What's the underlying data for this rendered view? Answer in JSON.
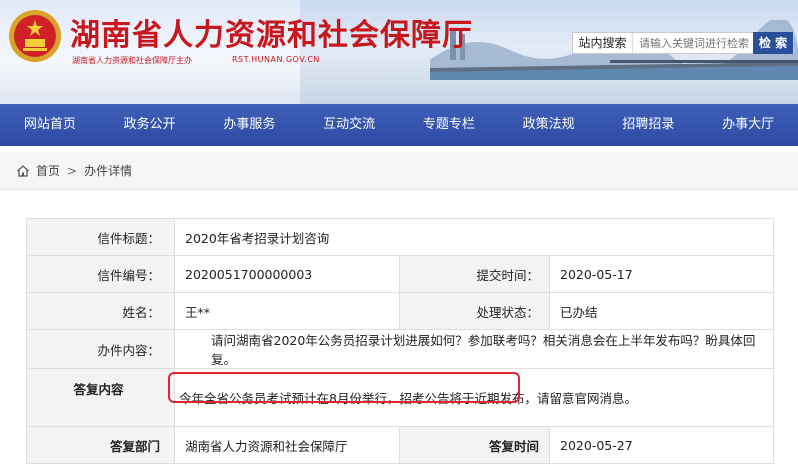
{
  "header": {
    "title": "湖南省人力资源和社会保障厅",
    "subtitle": "湖南省人力资源和社会保障厅主办",
    "url": "RST.HUNAN.GOV.CN",
    "search": {
      "label": "站内搜索",
      "placeholder": "请输入关键词进行检索",
      "button": "检 索"
    }
  },
  "nav": {
    "items": [
      "网站首页",
      "政务公开",
      "办事服务",
      "互动交流",
      "专题专栏",
      "政策法规",
      "招聘招录",
      "办事大厅"
    ]
  },
  "breadcrumb": {
    "home": "首页",
    "separator": ">",
    "current": "办件详情"
  },
  "detail": {
    "title_label": "信件标题：",
    "title_value": "2020年省考招录计划咨询",
    "number_label": "信件编号：",
    "number_value": "2020051700000003",
    "submit_time_label": "提交时间：",
    "submit_time_value": "2020-05-17",
    "name_label": "姓名：",
    "name_value": "王**",
    "status_label": "处理状态：",
    "status_value": "已办结",
    "content_label": "办件内容：",
    "content_value": "请问湖南省2020年公务员招录计划进展如何？参加联考吗？相关消息会在上半年发布吗？盼具体回复。",
    "reply_label": "答复内容",
    "reply_value": "今年全省公务员考试预计在8月份举行，招考公告将于近期发布，请留意官网消息。",
    "dept_label": "答复部门",
    "dept_value": "湖南省人力资源和社会保障厅",
    "reply_time_label": "答复时间",
    "reply_time_value": "2020-05-27"
  },
  "colors": {
    "brand_red": "#c8161d",
    "nav_blue": "#2d4aa3",
    "highlight_red": "#e3262b"
  },
  "icons": [
    "emblem-icon",
    "home-icon"
  ]
}
